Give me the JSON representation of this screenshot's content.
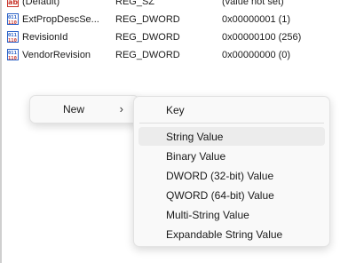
{
  "values": [
    {
      "name": "(Default)",
      "type": "REG_SZ",
      "data": "(value not set)",
      "icon": "string-value-icon"
    },
    {
      "name": "ExtPropDescSe...",
      "type": "REG_DWORD",
      "data": "0x00000001 (1)",
      "icon": "binary-value-icon"
    },
    {
      "name": "RevisionId",
      "type": "REG_DWORD",
      "data": "0x00000100 (256)",
      "icon": "binary-value-icon"
    },
    {
      "name": "VendorRevision",
      "type": "REG_DWORD",
      "data": "0x00000000 (0)",
      "icon": "binary-value-icon"
    }
  ],
  "context_menu": {
    "new_label": "New",
    "submenu_arrow": "›"
  },
  "submenu": {
    "key_label": "Key",
    "items": [
      "String Value",
      "Binary Value",
      "DWORD (32-bit) Value",
      "QWORD (64-bit) Value",
      "Multi-String Value",
      "Expandable String Value"
    ]
  },
  "colors": {
    "icon_blue": "#2b62c7",
    "icon_red": "#c8362c",
    "highlight": "#ececec"
  }
}
